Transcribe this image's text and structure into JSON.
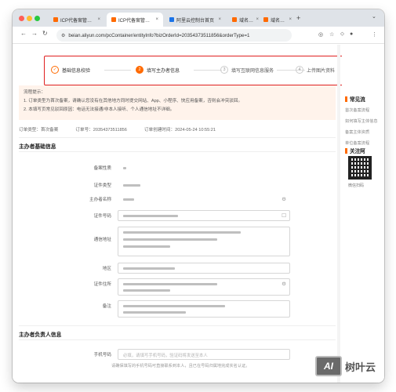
{
  "browser": {
    "tabs": [
      {
        "label": "ICP代备案管理系统",
        "active": false
      },
      {
        "label": "ICP代备案管理系统",
        "active": true
      },
      {
        "label": "阿里云控制台首页",
        "active": false
      },
      {
        "label": "域名控制台",
        "active": false
      },
      {
        "label": "域名控制台",
        "active": false
      }
    ],
    "url": "beian.aliyun.com/pcContainer/entityInfo?bizOrderId=20354373511856&orderType=1"
  },
  "steps": [
    {
      "label": "基础信息校验",
      "state": "done"
    },
    {
      "index": "2",
      "label": "填写主办者信息",
      "state": "current"
    },
    {
      "index": "3",
      "label": "填写互联网信息服务",
      "state": "todo"
    },
    {
      "index": "4",
      "label": "上传图片资料",
      "state": "todo"
    }
  ],
  "notice": {
    "title": "流程提示：",
    "items": [
      "1. 订单类型为首次备案，请确认您没有在其他地方同时提交网站、App、小程序、快应用备案，否则会冲突驳回。",
      "2. 本填写页常见驳回原因：电话无法接通/非本人接听、个人通信地址不详细。"
    ]
  },
  "order": {
    "type_label": "订单类型：",
    "type_value": "首次备案",
    "no_label": "订单号：",
    "no_value": "20354373511856",
    "created_label": "订单创建时间：",
    "created_value": "2024-05-24 10:55:21"
  },
  "sections": {
    "basic": "主办者基础信息",
    "responsible": "主办者负责人信息"
  },
  "form_labels": {
    "region": "备案性质",
    "cert_type": "证件类型",
    "owner_name": "主办者名称",
    "cert_no": "证件号码",
    "address": "通信地址",
    "area": "地区",
    "cert_address": "证件住所",
    "remark": "备注",
    "phone": "手机号码"
  },
  "phone": {
    "placeholder": "必填，请填写手机号码，验证码将发送至本人",
    "hint": "请确保填写的手机号码可直接联系到本人，且已在号码归属地完成实名认证。"
  },
  "right_panel": {
    "faq_title": "常见流",
    "faq_links": [
      "首次备案流程",
      "如何填写主体信息",
      "备案主体资质",
      "单位备案流程"
    ],
    "follow_title": "关注阿",
    "qr_caption": "微信扫码"
  },
  "watermark": {
    "logo": "AI",
    "text": "树叶云"
  },
  "colors": {
    "accent": "#ff6a00",
    "highlight_border": "#e02020",
    "notice_bg": "#fff3eb"
  }
}
